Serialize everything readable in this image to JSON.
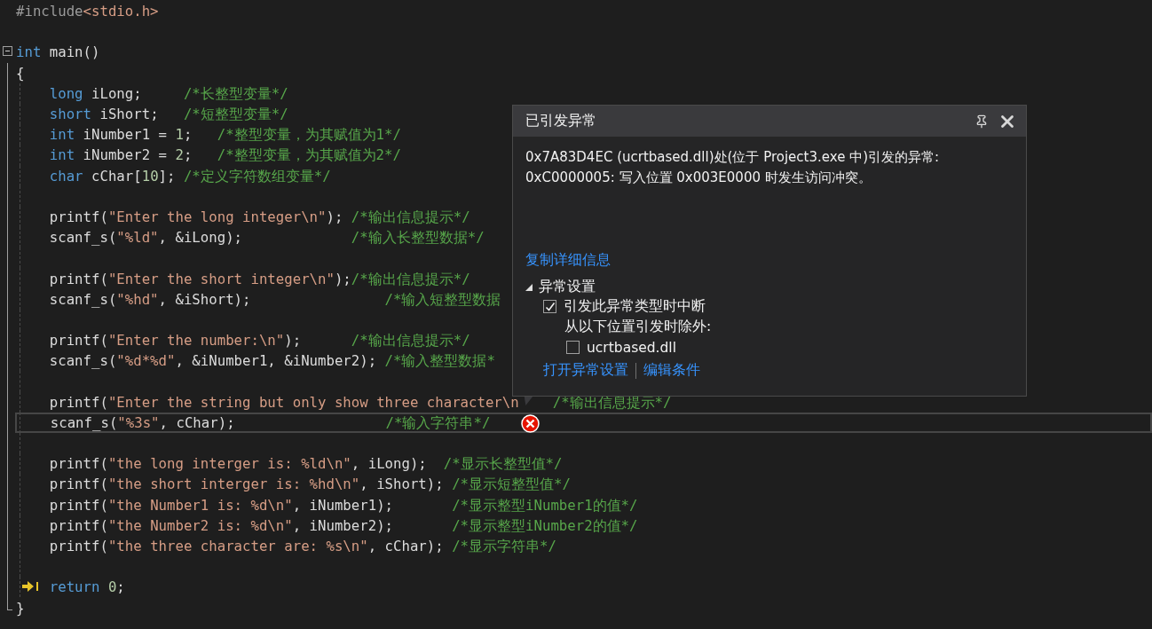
{
  "editor": {
    "lines": [
      {
        "kind": "plain",
        "highlighted": false,
        "error": false,
        "next": false,
        "tokens": [
          {
            "kind": "pre",
            "text": "#include"
          },
          {
            "kind": "str",
            "text": "<stdio.h>"
          }
        ]
      },
      {
        "kind": "plain",
        "highlighted": false,
        "error": false,
        "next": false
      },
      {
        "kind": "fold-start",
        "highlighted": false,
        "error": false,
        "next": false,
        "expanded": true,
        "tokens": [
          {
            "kind": "kw",
            "text": "int"
          },
          {
            "kind": "plain",
            "text": " main()"
          }
        ]
      },
      {
        "kind": "fold-body",
        "highlighted": false,
        "error": false,
        "next": false,
        "tokens": [
          {
            "kind": "plain",
            "text": "{"
          }
        ]
      },
      {
        "kind": "fold-body",
        "highlighted": false,
        "error": false,
        "next": false,
        "tokens": [
          {
            "kind": "kw",
            "text": "    long"
          },
          {
            "kind": "plain",
            "text": " iLong;     "
          },
          {
            "kind": "cmt",
            "text": "/*长整型变量*/"
          }
        ]
      },
      {
        "kind": "fold-body",
        "highlighted": false,
        "error": false,
        "next": false,
        "tokens": [
          {
            "kind": "kw",
            "text": "    short"
          },
          {
            "kind": "plain",
            "text": " iShort;   "
          },
          {
            "kind": "cmt",
            "text": "/*短整型变量*/"
          }
        ]
      },
      {
        "kind": "fold-body",
        "highlighted": false,
        "error": false,
        "next": false,
        "tokens": [
          {
            "kind": "kw",
            "text": "    int"
          },
          {
            "kind": "plain",
            "text": " iNumber1 = "
          },
          {
            "kind": "num",
            "text": "1"
          },
          {
            "kind": "plain",
            "text": ";   "
          },
          {
            "kind": "cmt",
            "text": "/*整型变量，为其赋值为1*/"
          }
        ]
      },
      {
        "kind": "fold-body",
        "highlighted": false,
        "error": false,
        "next": false,
        "tokens": [
          {
            "kind": "kw",
            "text": "    int"
          },
          {
            "kind": "plain",
            "text": " iNumber2 = "
          },
          {
            "kind": "num",
            "text": "2"
          },
          {
            "kind": "plain",
            "text": ";   "
          },
          {
            "kind": "cmt",
            "text": "/*整型变量，为其赋值为2*/"
          }
        ]
      },
      {
        "kind": "fold-body",
        "highlighted": false,
        "error": false,
        "next": false,
        "tokens": [
          {
            "kind": "kw",
            "text": "    char"
          },
          {
            "kind": "plain",
            "text": " cChar["
          },
          {
            "kind": "num",
            "text": "10"
          },
          {
            "kind": "plain",
            "text": "]; "
          },
          {
            "kind": "cmt",
            "text": "/*定义字符数组变量*/"
          }
        ]
      },
      {
        "kind": "fold-body",
        "highlighted": false,
        "error": false,
        "next": false
      },
      {
        "kind": "fold-body",
        "highlighted": false,
        "error": false,
        "next": false,
        "tokens": [
          {
            "kind": "plain",
            "text": "    printf("
          },
          {
            "kind": "str",
            "text": "\"Enter the long integer\\n\""
          },
          {
            "kind": "plain",
            "text": "); "
          },
          {
            "kind": "cmt",
            "text": "/*输出信息提示*/"
          }
        ]
      },
      {
        "kind": "fold-body",
        "highlighted": false,
        "error": false,
        "next": false,
        "tokens": [
          {
            "kind": "plain",
            "text": "    scanf_s("
          },
          {
            "kind": "str",
            "text": "\"%ld\""
          },
          {
            "kind": "plain",
            "text": ", &iLong);             "
          },
          {
            "kind": "cmt",
            "text": "/*输入长整型数据*/"
          }
        ]
      },
      {
        "kind": "fold-body",
        "highlighted": false,
        "error": false,
        "next": false
      },
      {
        "kind": "fold-body",
        "highlighted": false,
        "error": false,
        "next": false,
        "tokens": [
          {
            "kind": "plain",
            "text": "    printf("
          },
          {
            "kind": "str",
            "text": "\"Enter the short integer\\n\""
          },
          {
            "kind": "plain",
            "text": ");"
          },
          {
            "kind": "cmt",
            "text": "/*输出信息提示*/"
          }
        ]
      },
      {
        "kind": "fold-body",
        "highlighted": false,
        "error": false,
        "next": false,
        "tokens": [
          {
            "kind": "plain",
            "text": "    scanf_s("
          },
          {
            "kind": "str",
            "text": "\"%hd\""
          },
          {
            "kind": "plain",
            "text": ", &iShort);                "
          },
          {
            "kind": "cmt",
            "text": "/*输入短整型数据"
          }
        ]
      },
      {
        "kind": "fold-body",
        "highlighted": false,
        "error": false,
        "next": false
      },
      {
        "kind": "fold-body",
        "highlighted": false,
        "error": false,
        "next": false,
        "tokens": [
          {
            "kind": "plain",
            "text": "    printf("
          },
          {
            "kind": "str",
            "text": "\"Enter the number:\\n\""
          },
          {
            "kind": "plain",
            "text": ");      "
          },
          {
            "kind": "cmt",
            "text": "/*输出信息提示*/"
          }
        ]
      },
      {
        "kind": "fold-body",
        "highlighted": false,
        "error": false,
        "next": false,
        "tokens": [
          {
            "kind": "plain",
            "text": "    scanf_s("
          },
          {
            "kind": "str",
            "text": "\"%d*%d\""
          },
          {
            "kind": "plain",
            "text": ", &iNumber1, &iNumber2); "
          },
          {
            "kind": "cmt",
            "text": "/*输入整型数据*"
          }
        ]
      },
      {
        "kind": "fold-body",
        "highlighted": false,
        "error": false,
        "next": false
      },
      {
        "kind": "fold-body",
        "highlighted": false,
        "error": false,
        "next": false,
        "tokens": [
          {
            "kind": "plain",
            "text": "    printf("
          },
          {
            "kind": "str",
            "text": "\"Enter the string but only show three character\\n"
          },
          {
            "kind": "far-cmt",
            "text": "/*输出信息提示*/"
          }
        ]
      },
      {
        "kind": "fold-body",
        "highlighted": true,
        "error": true,
        "next": false,
        "tokens": [
          {
            "kind": "plain",
            "text": "    scanf_s("
          },
          {
            "kind": "str",
            "text": "\"%3s\""
          },
          {
            "kind": "plain",
            "text": ", cChar);                  "
          },
          {
            "kind": "cmt",
            "text": "/*输入字符串*/"
          }
        ]
      },
      {
        "kind": "fold-body",
        "highlighted": false,
        "error": false,
        "next": false
      },
      {
        "kind": "fold-body",
        "highlighted": false,
        "error": false,
        "next": false,
        "tokens": [
          {
            "kind": "plain",
            "text": "    printf("
          },
          {
            "kind": "str",
            "text": "\"the long interger is: %ld\\n\""
          },
          {
            "kind": "plain",
            "text": ", iLong);  "
          },
          {
            "kind": "cmt",
            "text": "/*显示长整型值*/"
          }
        ]
      },
      {
        "kind": "fold-body",
        "highlighted": false,
        "error": false,
        "next": false,
        "tokens": [
          {
            "kind": "plain",
            "text": "    printf("
          },
          {
            "kind": "str",
            "text": "\"the short interger is: %hd\\n\""
          },
          {
            "kind": "plain",
            "text": ", iShort); "
          },
          {
            "kind": "cmt",
            "text": "/*显示短整型值*/"
          }
        ]
      },
      {
        "kind": "fold-body",
        "highlighted": false,
        "error": false,
        "next": false,
        "tokens": [
          {
            "kind": "plain",
            "text": "    printf("
          },
          {
            "kind": "str",
            "text": "\"the Number1 is: %d\\n\""
          },
          {
            "kind": "plain",
            "text": ", iNumber1);       "
          },
          {
            "kind": "cmt",
            "text": "/*显示整型iNumber1的值*/"
          }
        ]
      },
      {
        "kind": "fold-body",
        "highlighted": false,
        "error": false,
        "next": false,
        "tokens": [
          {
            "kind": "plain",
            "text": "    printf("
          },
          {
            "kind": "str",
            "text": "\"the Number2 is: %d\\n\""
          },
          {
            "kind": "plain",
            "text": ", iNumber2);       "
          },
          {
            "kind": "cmt",
            "text": "/*显示整型iNumber2的值*/"
          }
        ]
      },
      {
        "kind": "fold-body",
        "highlighted": false,
        "error": false,
        "next": false,
        "tokens": [
          {
            "kind": "plain",
            "text": "    printf("
          },
          {
            "kind": "str",
            "text": "\"the three character are: %s\\n\""
          },
          {
            "kind": "plain",
            "text": ", cChar); "
          },
          {
            "kind": "cmt",
            "text": "/*显示字符串*/"
          }
        ]
      },
      {
        "kind": "fold-body",
        "highlighted": false,
        "error": false,
        "next": false
      },
      {
        "kind": "fold-body",
        "highlighted": false,
        "error": false,
        "next": true,
        "tokens": [
          {
            "kind": "kw",
            "text": "    return"
          },
          {
            "kind": "num",
            "text": " 0"
          },
          {
            "kind": "plain",
            "text": ";"
          }
        ]
      },
      {
        "kind": "fold-end",
        "highlighted": false,
        "error": false,
        "next": false,
        "tokens": [
          {
            "kind": "plain",
            "text": "}"
          }
        ]
      }
    ]
  },
  "popup": {
    "title": "已引发异常",
    "message": [
      "0x7A83D4EC (ucrtbased.dll)处(位于 Project3.exe 中)引发的异常:",
      "0xC0000005: 写入位置 0x003E0000 时发生访问冲突。"
    ],
    "copy_link": "复制详细信息",
    "settings": {
      "label": "异常设置",
      "expanded": true,
      "break_option": {
        "label": "引发此异常类型时中断",
        "checked": true
      },
      "except_label": "从以下位置引发时除外:",
      "exceptions": [
        {
          "label": "ucrtbased.dll",
          "checked": false
        }
      ]
    },
    "links": [
      "打开异常设置",
      "编辑条件"
    ]
  }
}
